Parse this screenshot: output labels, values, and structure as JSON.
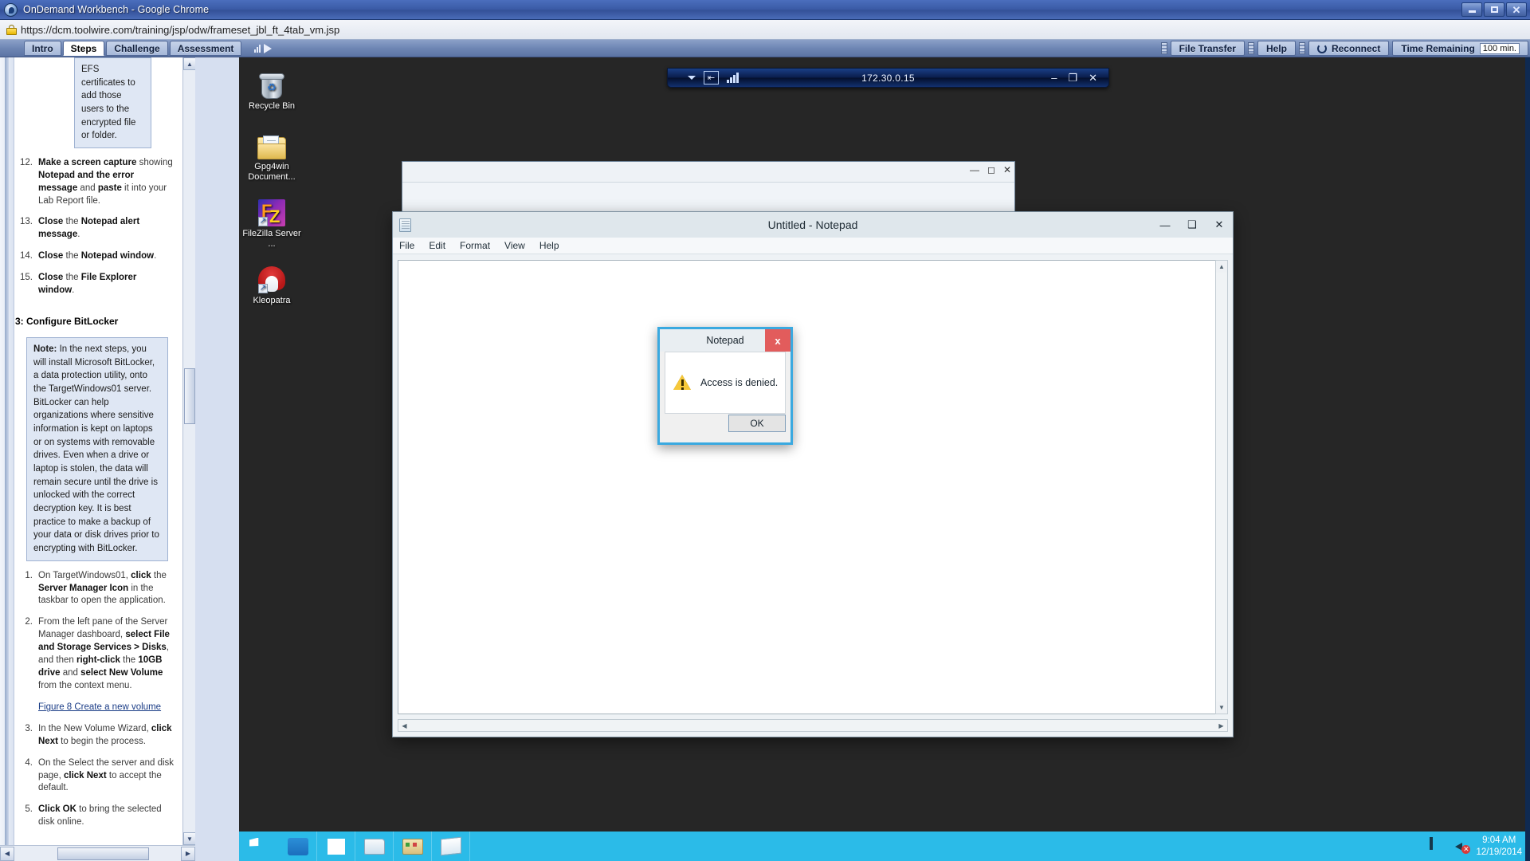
{
  "browser": {
    "title": "OnDemand Workbench - Google Chrome",
    "url": "https://dcm.toolwire.com/training/jsp/odw/frameset_jbl_ft_4tab_vm.jsp",
    "minimize_label": "–",
    "maximize_label": "□",
    "close_label": "✕"
  },
  "labbar": {
    "tabs": [
      {
        "label": "Intro",
        "active": false
      },
      {
        "label": "Steps",
        "active": true
      },
      {
        "label": "Challenge",
        "active": false
      },
      {
        "label": "Assessment",
        "active": false
      }
    ],
    "file_transfer": "File Transfer",
    "help": "Help",
    "reconnect": "Reconnect",
    "time_remaining_label": "Time Remaining",
    "time_remaining_value": "100 min."
  },
  "lab_pane": {
    "top_callout": "EFS certificates to add those users to the encrypted file or folder.",
    "steps_upper": [
      {
        "num": "12.",
        "html": "<b>Make a screen capture</b> showing <b>Notepad and the error message</b> and <b>paste</b> it into your Lab Report file."
      },
      {
        "num": "13.",
        "html": "<b>Close</b> the <b>Notepad alert message</b>."
      },
      {
        "num": "14.",
        "html": "<b>Close</b> the <b>Notepad window</b>."
      },
      {
        "num": "15.",
        "html": "<b>Close</b> the <b>File Explorer window</b>."
      }
    ],
    "section_heading": "3: Configure BitLocker",
    "note_html": "<b>Note:</b> In the next steps, you will install Microsoft BitLocker, a data protection utility, onto the TargetWindows01 server. BitLocker can help organizations where sensitive information is kept on laptops or on systems with removable drives. Even when a drive or laptop is stolen, the data will remain secure until the drive is unlocked with the correct decryption key. It is best practice to make a backup of your data or disk drives prior to encrypting with BitLocker.",
    "steps_lower_a": [
      {
        "num": "1.",
        "html": "On TargetWindows01, <b>click</b> the <b>Server Manager Icon</b> in the taskbar to open the application."
      },
      {
        "num": "2.",
        "html": "From the left pane of the Server Manager dashboard, <b>select File and Storage Services &gt; Disks</b>, and then <b>right-click</b> the <b>10GB drive</b> and <b>select New Volume</b> from the context menu."
      }
    ],
    "figure_link": "Figure 8 Create a new volume",
    "steps_lower_b": [
      {
        "num": "3.",
        "html": "In the New Volume Wizard, <b>click Next</b> to begin the process."
      },
      {
        "num": "4.",
        "html": "On the Select the server and disk page, <b>click Next</b> to accept the default."
      },
      {
        "num": "5.",
        "html": "<b>Click OK</b> to bring the selected disk online."
      }
    ]
  },
  "vm": {
    "ip_address": "172.30.0.15",
    "toolbar_minimize": "–",
    "toolbar_restore": "❐",
    "toolbar_close": "✕",
    "desktop_icons": [
      {
        "label": "Recycle Bin",
        "icon": "recycle-bin-icon"
      },
      {
        "label": "Gpg4win Document...",
        "icon": "folder-icon"
      },
      {
        "label": "FileZilla Server ...",
        "icon": "filezilla-icon"
      },
      {
        "label": "Kleopatra",
        "icon": "kleopatra-icon"
      }
    ]
  },
  "notepad": {
    "title": "Untitled - Notepad",
    "menu": [
      "File",
      "Edit",
      "Format",
      "View",
      "Help"
    ],
    "minimize_label": "—",
    "maximize_label": "❑",
    "close_label": "✕",
    "document_text": ""
  },
  "alert": {
    "title": "Notepad",
    "message": "Access is denied.",
    "ok_label": "OK",
    "close_label": "x",
    "accent_color": "#3aa9e0",
    "close_color": "#e25c5c"
  },
  "taskbar": {
    "clock_time": "9:04 AM",
    "clock_date": "12/19/2014",
    "accent_color": "#2bbbe8",
    "items": [
      "start-button",
      "ie-icon",
      "windows-explorer-icon",
      "folder-icon",
      "server-manager-icon",
      "notepad-icon"
    ]
  }
}
